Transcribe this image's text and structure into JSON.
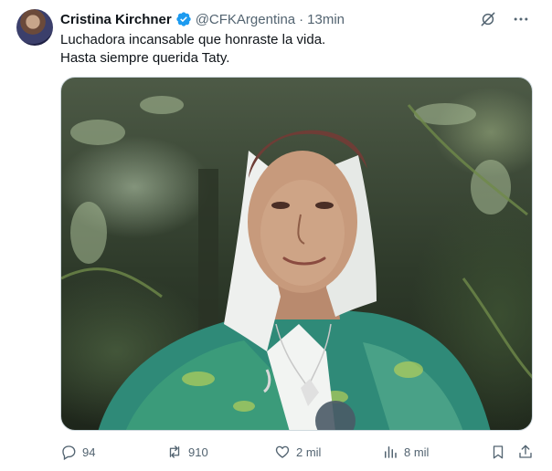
{
  "tweet": {
    "author": {
      "display_name": "Cristina Kirchner",
      "handle": "@CFKArgentina",
      "separator": "·",
      "time": "13min",
      "verified": true
    },
    "text_lines": [
      "Luchadora incansable que honraste la vida.",
      "Hasta siempre querida Taty."
    ],
    "stats": {
      "replies": "94",
      "reposts": "910",
      "likes": "2 mil",
      "views": "8 mil"
    },
    "icons": {
      "verified": "verified-badge-icon",
      "grok": "grok-icon",
      "more": "more-options-icon",
      "reply": "reply-icon",
      "repost": "repost-icon",
      "like": "heart-icon",
      "views": "views-icon",
      "bookmark": "bookmark-icon",
      "share": "share-icon"
    },
    "colors": {
      "verified": "#1d9bf0",
      "secondary_text": "#536471",
      "primary_text": "#0f1419"
    }
  }
}
